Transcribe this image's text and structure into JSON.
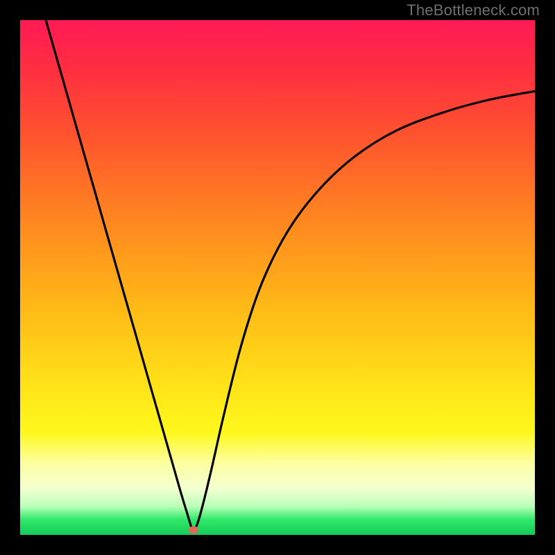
{
  "attribution": "TheBottleneck.com",
  "colors": {
    "page_bg": "#000000",
    "attribution_text": "#6f6f6f",
    "curve_stroke": "#000000",
    "marker_fill": "#db6a5b",
    "gradient_top": "#ff1a55",
    "gradient_bottom": "#13cc58"
  },
  "chart_data": {
    "type": "line",
    "title": "",
    "xlabel": "",
    "ylabel": "",
    "xlim": [
      0,
      1
    ],
    "ylim": [
      0,
      1
    ],
    "grid": false,
    "legend": false,
    "annotations": [],
    "series": [
      {
        "name": "curve",
        "x": [
          0.05,
          0.08,
          0.11,
          0.14,
          0.17,
          0.2,
          0.23,
          0.26,
          0.29,
          0.31,
          0.325,
          0.334,
          0.34,
          0.35,
          0.37,
          0.395,
          0.43,
          0.47,
          0.52,
          0.58,
          0.65,
          0.73,
          0.82,
          0.91,
          1.0
        ],
        "y": [
          1.0,
          0.895,
          0.79,
          0.685,
          0.58,
          0.475,
          0.37,
          0.265,
          0.16,
          0.09,
          0.04,
          0.012,
          0.012,
          0.04,
          0.12,
          0.23,
          0.37,
          0.49,
          0.59,
          0.67,
          0.735,
          0.785,
          0.82,
          0.845,
          0.862
        ]
      }
    ],
    "marker": {
      "x": 0.337,
      "y": 0.01
    }
  }
}
